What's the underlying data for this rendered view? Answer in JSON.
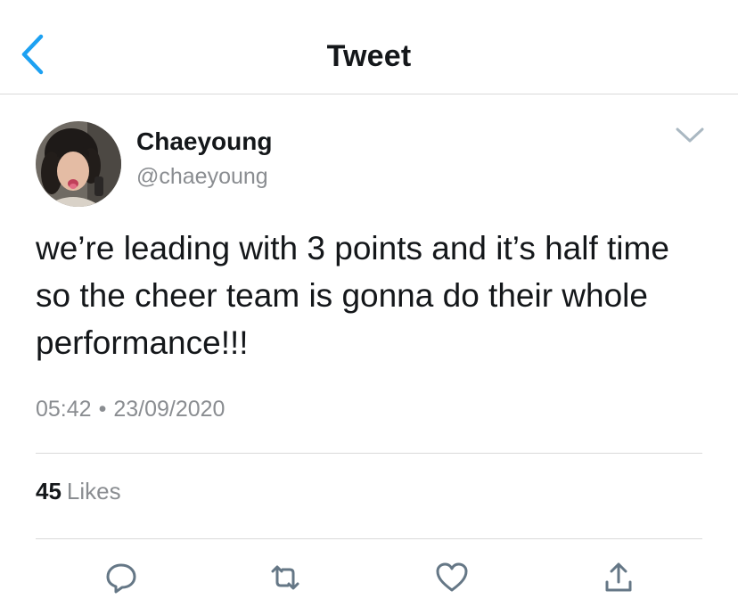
{
  "header": {
    "title": "Tweet",
    "back_icon": "chevron-left-icon"
  },
  "tweet": {
    "author": {
      "display_name": "Chaeyoung",
      "handle": "@chaeyoung"
    },
    "menu_icon": "chevron-down-icon",
    "text": "we’re leading with 3 points and it’s half time so the cheer team is gonna do their whole performance!!!",
    "time": "05:42",
    "separator": "•",
    "date": "23/09/2020",
    "likes": {
      "count": "45",
      "label": "Likes"
    }
  },
  "actions": [
    {
      "name": "reply",
      "icon": "reply-icon"
    },
    {
      "name": "retweet",
      "icon": "retweet-icon"
    },
    {
      "name": "like",
      "icon": "heart-icon"
    },
    {
      "name": "share",
      "icon": "share-icon"
    }
  ],
  "colors": {
    "accent": "#1da1f2",
    "text": "#14171a",
    "secondary_text": "#8a8d91",
    "divider": "#d9d9d9",
    "icon_gray": "#657786"
  }
}
